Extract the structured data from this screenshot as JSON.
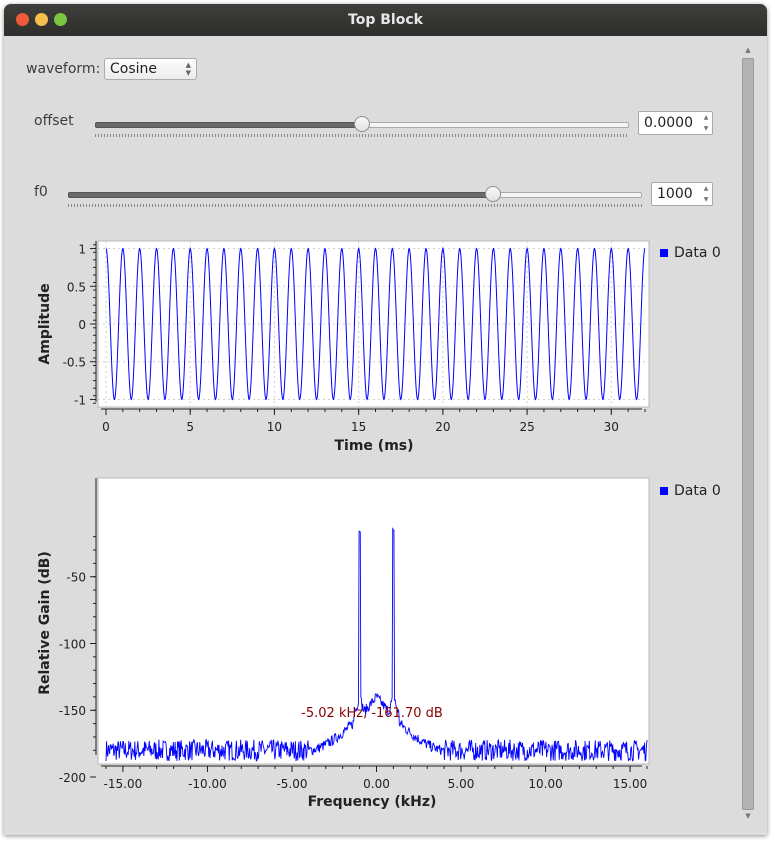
{
  "window": {
    "title": "Top Block"
  },
  "controls": {
    "waveform": {
      "label": "waveform:",
      "value": "Cosine"
    },
    "offset": {
      "label": "offset",
      "value": "0.0000",
      "fraction": 0.5
    },
    "f0": {
      "label": "f0",
      "value": "1000",
      "fraction": 0.74
    }
  },
  "time_plot": {
    "legend": "Data 0",
    "chart_data": {
      "type": "line",
      "xlabel": "Time (ms)",
      "ylabel": "Amplitude",
      "xlim": [
        0,
        32
      ],
      "ylim": [
        -1.1,
        1.1
      ],
      "xticks": [
        "0",
        "5",
        "10",
        "15",
        "20",
        "25",
        "30"
      ],
      "yticks": [
        "1",
        "0.5",
        "0",
        "-0.5",
        "-1"
      ],
      "grid": true,
      "legend_position": "right",
      "series": [
        {
          "name": "Data 0",
          "function": "cosine",
          "frequency_hz": 1000,
          "amplitude": 1,
          "color": "#0000ff"
        }
      ]
    }
  },
  "freq_plot": {
    "legend": "Data 0",
    "marker_label": "-5.02 kHz, -161.70 dB",
    "chart_data": {
      "type": "line",
      "xlabel": "Frequency (kHz)",
      "ylabel": "Relative Gain (dB)",
      "xlim": [
        -16,
        16
      ],
      "ylim": [
        -205,
        -128
      ],
      "xticks": [
        "-15.00",
        "-10.00",
        "-5.00",
        "0.00",
        "5.00",
        "10.00",
        "15.00"
      ],
      "yticks": [
        "-50",
        "-100",
        "-150",
        "-200"
      ],
      "legend_position": "right",
      "series": [
        {
          "name": "Data 0",
          "color": "#0000ff",
          "peaks": [
            {
              "x": -1.0,
              "y": -15
            },
            {
              "x": 1.0,
              "y": -15
            }
          ],
          "noise_floor_db": -180,
          "skirt_peak_db": -140
        }
      ]
    }
  }
}
